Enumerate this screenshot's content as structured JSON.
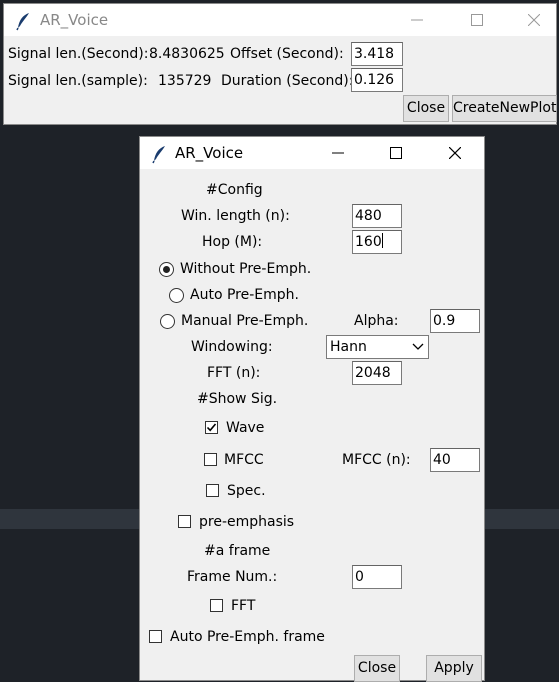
{
  "main_window": {
    "title": "AR_Voice",
    "signal_len_second_label": "Signal len.(Second):",
    "signal_len_second_value": "8.4830625",
    "signal_len_sample_label": "Signal len.(sample):",
    "signal_len_sample_value": "135729",
    "offset_label": "Offset (Second):",
    "offset_value": "3.418",
    "duration_label": "Duration (Second):",
    "duration_value": "0.126",
    "close_label": "Close",
    "create_new_plot_label": "CreateNewPlot"
  },
  "config_window": {
    "title": "AR_Voice",
    "config_header": "#Config",
    "win_length_label": "Win. length (n):",
    "win_length_value": "480",
    "hop_label": "Hop (M):",
    "hop_value": "160",
    "without_pre_emph_label": "Without Pre-Emph.",
    "auto_pre_emph_label": "Auto Pre-Emph.",
    "manual_pre_emph_label": "Manual Pre-Emph.",
    "alpha_label": "Alpha:",
    "alpha_value": "0.9",
    "windowing_label": "Windowing:",
    "windowing_value": "Hann",
    "fft_n_label": "FFT (n):",
    "fft_n_value": "2048",
    "show_sig_header": "#Show Sig.",
    "wave_label": "Wave",
    "wave_checked": true,
    "mfcc_label": "MFCC",
    "mfcc_checked": false,
    "mfcc_n_label": "MFCC (n):",
    "mfcc_n_value": "40",
    "spec_label": "Spec.",
    "spec_checked": false,
    "pre_emphasis_label": "pre-emphasis",
    "pre_emphasis_checked": false,
    "a_frame_header": "#a frame",
    "frame_num_label": "Frame Num.:",
    "frame_num_value": "0",
    "fft_frame_label": "FFT",
    "fft_frame_checked": false,
    "auto_pre_emph_frame_label": "Auto Pre-Emph. frame",
    "auto_pre_emph_frame_checked": false,
    "close_label": "Close",
    "apply_label": "Apply",
    "selected_pre_emph_mode": "without"
  },
  "colors": {
    "desktop": "#1e2228",
    "window_bg": "#f0f0f0",
    "titlebar_bg": "#ffffff"
  }
}
